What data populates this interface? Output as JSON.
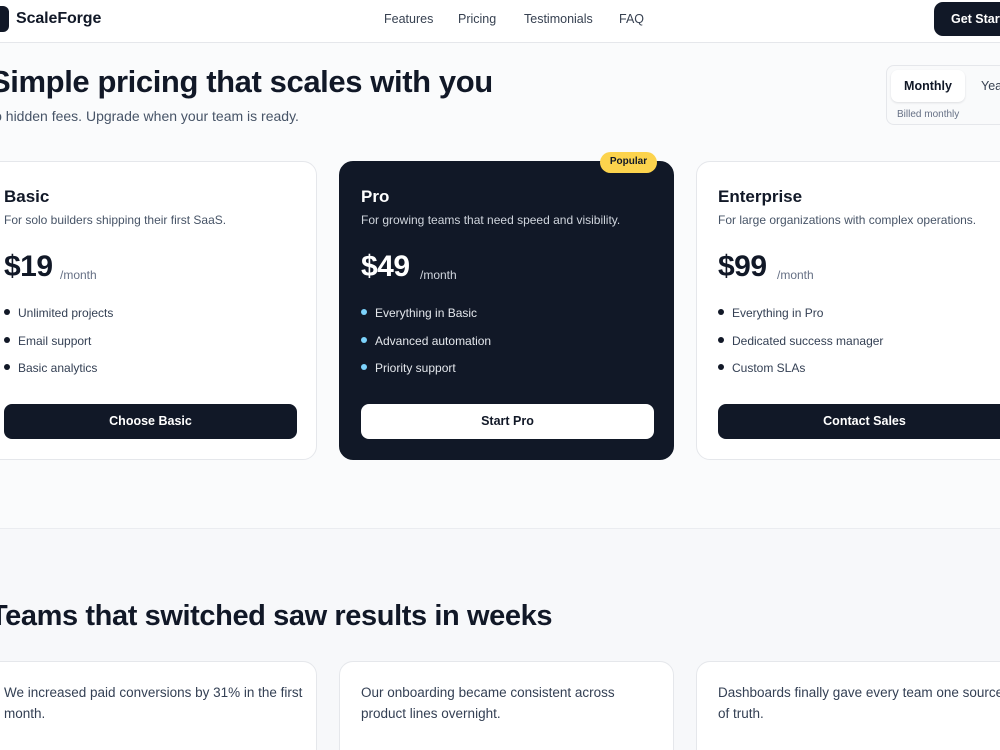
{
  "brand": {
    "name": "ScaleForge"
  },
  "nav": {
    "items": [
      "Features",
      "Pricing",
      "Testimonials",
      "FAQ"
    ],
    "cta_label": "Get Started"
  },
  "hero": {
    "title": "Simple pricing that scales with you",
    "subtitle": "No hidden fees. Upgrade when your team is ready."
  },
  "billing": {
    "options": [
      "Monthly",
      "Yearly"
    ],
    "selected": "Monthly",
    "note": "Billed monthly"
  },
  "plans": [
    {
      "name": "Basic",
      "description": "For solo builders shipping their first SaaS.",
      "price": "$19",
      "period": "/month",
      "features": [
        "Unlimited projects",
        "Email support",
        "Basic analytics"
      ],
      "button": "Choose Basic"
    },
    {
      "name": "Pro",
      "badge": "Popular",
      "description": "For growing teams that need speed and visibility.",
      "price": "$49",
      "period": "/month",
      "features": [
        "Everything in Basic",
        "Advanced automation",
        "Priority support"
      ],
      "button": "Start Pro"
    },
    {
      "name": "Enterprise",
      "description": "For large organizations with complex operations.",
      "price": "$99",
      "period": "/month",
      "features": [
        "Everything in Pro",
        "Dedicated success manager",
        "Custom SLAs"
      ],
      "button": "Contact Sales"
    }
  ],
  "testimonials": {
    "title": "Teams that switched saw results in weeks",
    "quotes": [
      "We increased paid conversions by 31% in the first month.",
      "Our onboarding became consistent across product lines overnight.",
      "Dashboards finally gave every team one source of truth."
    ]
  },
  "colors": {
    "primary": "#111827",
    "badge": "#fcd34d",
    "accent_dot": "#7dd3fc",
    "background": "#fafbfc"
  }
}
